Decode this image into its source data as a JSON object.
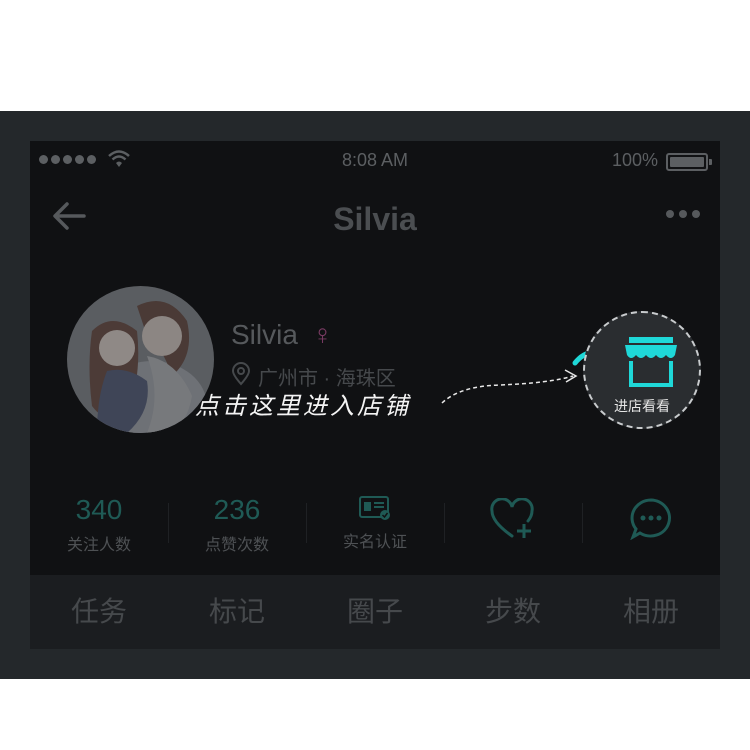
{
  "status_bar": {
    "time": "8:08 AM",
    "battery": "100%"
  },
  "nav": {
    "title": "Silvia"
  },
  "profile": {
    "name": "Silvia",
    "gender_symbol": "♀",
    "location": "广州市 · 海珠区",
    "hint": "点击这里进入店铺",
    "store_button": "进店看看"
  },
  "stats": [
    {
      "value": "340",
      "label": "关注人数"
    },
    {
      "value": "236",
      "label": "点赞次数"
    },
    {
      "label": "实名认证",
      "icon": "id-card-icon"
    },
    {
      "icon": "heart-plus-icon"
    },
    {
      "icon": "chat-bubble-icon"
    }
  ],
  "tabs": [
    "任务",
    "标记",
    "圈子",
    "步数",
    "相册"
  ],
  "colors": {
    "accent": "#1fd8d8",
    "stat_green": "#1f5a55",
    "gender": "#7a3b63"
  }
}
